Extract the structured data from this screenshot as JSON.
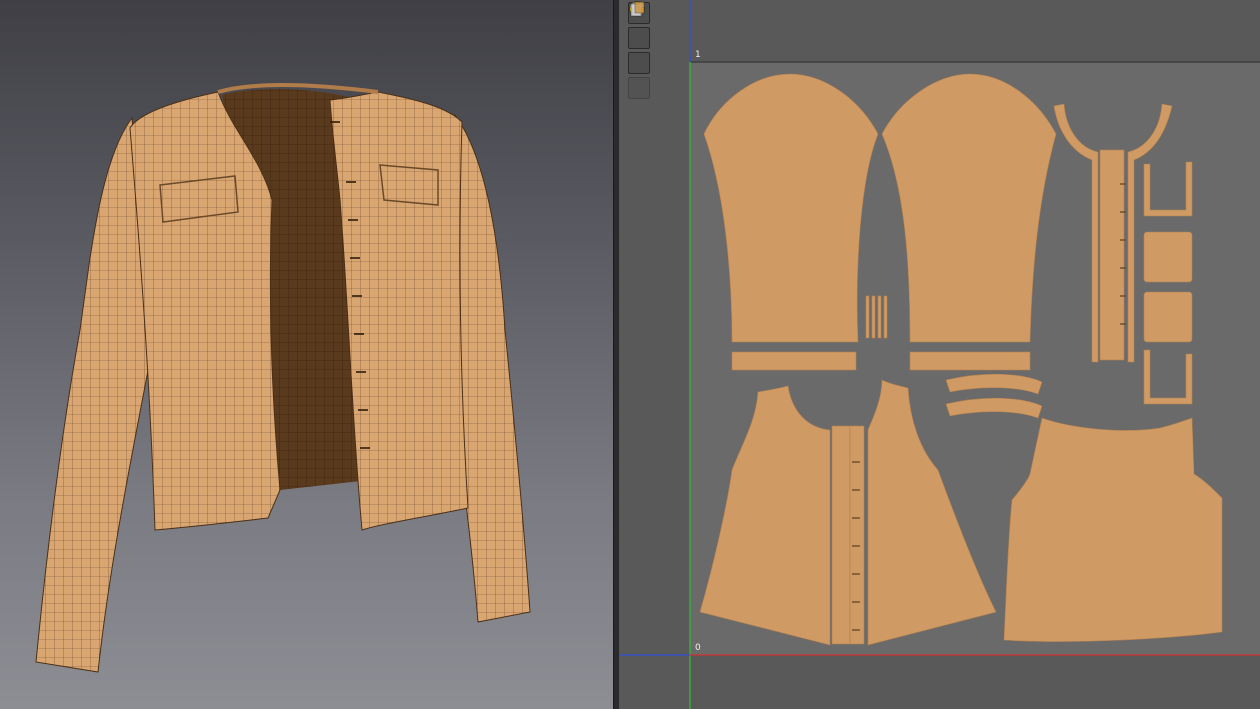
{
  "uv_editor": {
    "axis_label_top": "1",
    "axis_label_origin": "0",
    "toolbar": [
      {
        "name": "show-garment-button",
        "icon": "shirt-eye-icon"
      },
      {
        "name": "info-button",
        "icon": "info-icon"
      },
      {
        "name": "texture-button",
        "icon": "texture-sheet-icon"
      },
      {
        "name": "avatar-button",
        "icon": "garment-gray-icon",
        "disabled": true
      }
    ]
  },
  "colors": {
    "fabric": "#CF9A63",
    "uv_background": "#6A6A6A",
    "uv_axis_red": "#D03030",
    "uv_axis_green": "#2FC23A",
    "uv_axis_blue": "#3050D8",
    "interior": "#5A3A1C"
  }
}
